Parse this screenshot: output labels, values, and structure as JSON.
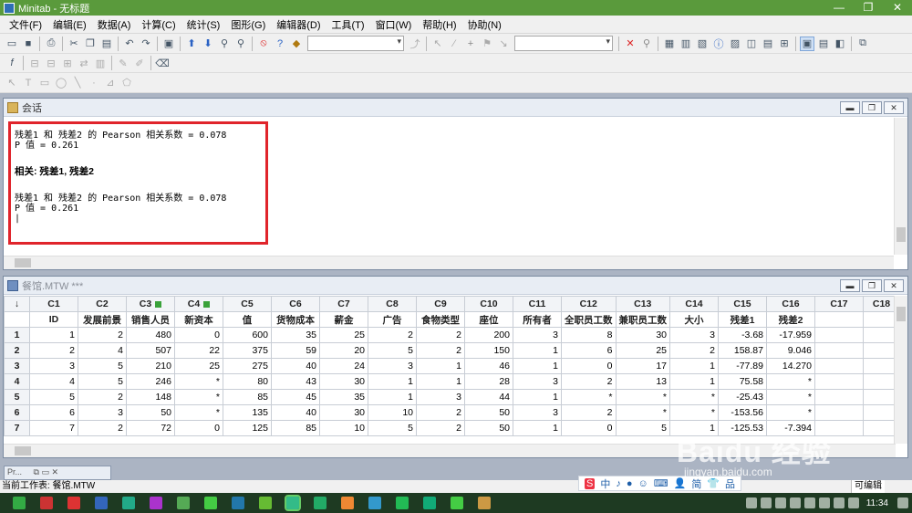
{
  "window": {
    "title": "Minitab - 无标题",
    "buttons": [
      "—",
      "❐",
      "✕"
    ]
  },
  "menu": [
    "文件(F)",
    "编辑(E)",
    "数据(A)",
    "计算(C)",
    "统计(S)",
    "图形(G)",
    "编辑器(D)",
    "工具(T)",
    "窗口(W)",
    "帮助(H)",
    "协助(N)"
  ],
  "session": {
    "title": "会话",
    "lines": [
      {
        "text": "残差1 和 残差2 的 Pearson 相关系数 = 0.078",
        "style": "normal"
      },
      {
        "text": "P 值 = 0.261",
        "style": "normal"
      },
      {
        "text": "",
        "style": "gap"
      },
      {
        "text": "相关: 残差1, 残差2",
        "style": "bold"
      },
      {
        "text": "",
        "style": "gap"
      },
      {
        "text": "残差1 和 残差2 的 Pearson 相关系数 = 0.078",
        "style": "normal"
      },
      {
        "text": "P 值 = 0.261",
        "style": "normal"
      },
      {
        "text": "|",
        "style": "normal"
      }
    ]
  },
  "worksheet": {
    "title": "餐馆.MTW ***",
    "corner": "↓",
    "columns": [
      "C1",
      "C2",
      "C3",
      "C4",
      "C5",
      "C6",
      "C7",
      "C8",
      "C9",
      "C10",
      "C11",
      "C12",
      "C13",
      "C14",
      "C15",
      "C16",
      "C17",
      "C18"
    ],
    "flagged": [
      2,
      3
    ],
    "names": [
      "ID",
      "发展前景",
      "销售人员",
      "新资本",
      "值",
      "货物成本",
      "薪金",
      "广告",
      "食物类型",
      "座位",
      "所有者",
      "全职员工数",
      "兼职员工数",
      "大小",
      "残差1",
      "残差2",
      "",
      ""
    ],
    "rows": [
      {
        "n": "1",
        "cells": [
          "1",
          "2",
          "480",
          "0",
          "600",
          "35",
          "25",
          "2",
          "2",
          "200",
          "3",
          "8",
          "30",
          "3",
          "-3.68",
          "-17.959",
          "",
          ""
        ]
      },
      {
        "n": "2",
        "cells": [
          "2",
          "4",
          "507",
          "22",
          "375",
          "59",
          "20",
          "5",
          "2",
          "150",
          "1",
          "6",
          "25",
          "2",
          "158.87",
          "9.046",
          "",
          ""
        ]
      },
      {
        "n": "3",
        "cells": [
          "3",
          "5",
          "210",
          "25",
          "275",
          "40",
          "24",
          "3",
          "1",
          "46",
          "1",
          "0",
          "17",
          "1",
          "-77.89",
          "14.270",
          "",
          ""
        ]
      },
      {
        "n": "4",
        "cells": [
          "4",
          "5",
          "246",
          "*",
          "80",
          "43",
          "30",
          "1",
          "1",
          "28",
          "3",
          "2",
          "13",
          "1",
          "75.58",
          "*",
          "",
          ""
        ]
      },
      {
        "n": "5",
        "cells": [
          "5",
          "2",
          "148",
          "*",
          "85",
          "45",
          "35",
          "1",
          "3",
          "44",
          "1",
          "*",
          "*",
          "*",
          "-25.43",
          "*",
          "",
          ""
        ]
      },
      {
        "n": "6",
        "cells": [
          "6",
          "3",
          "50",
          "*",
          "135",
          "40",
          "30",
          "10",
          "2",
          "50",
          "3",
          "2",
          "*",
          "*",
          "-153.56",
          "*",
          "",
          ""
        ]
      },
      {
        "n": "7",
        "cells": [
          "7",
          "2",
          "72",
          "0",
          "125",
          "85",
          "10",
          "5",
          "2",
          "50",
          "1",
          "0",
          "5",
          "1",
          "-125.53",
          "-7.394",
          "",
          ""
        ]
      }
    ]
  },
  "minimized": [
    {
      "label": "Pr..."
    }
  ],
  "status": {
    "text": "当前工作表: 餐馆.MTW",
    "mode": "可编辑"
  },
  "ime": {
    "items": [
      "中",
      "♪",
      "●",
      "☺",
      "⌨",
      "👤",
      "简",
      "👕",
      "品"
    ]
  },
  "clock": "11:34",
  "watermark": {
    "big": "Baidu 经验",
    "small": "jingyan.baidu.com"
  }
}
